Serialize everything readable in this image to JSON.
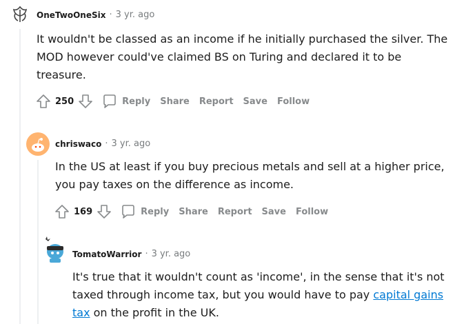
{
  "comments": [
    {
      "author": "OneTwoOneSix",
      "separator": "·",
      "time": "3 yr. ago",
      "body": "It wouldn't be classed as an income if he initially purchased the silver. The MOD however could've claimed BS on Turing and declared it to be treasure.",
      "score": "250",
      "actions": {
        "reply": "Reply",
        "share": "Share",
        "report": "Report",
        "save": "Save",
        "follow": "Follow"
      }
    },
    {
      "author": "chriswaco",
      "separator": "·",
      "time": "3 yr. ago",
      "body": "In the US at least if you buy precious metals and sell at a higher price, you pay taxes on the difference as income.",
      "score": "169",
      "actions": {
        "reply": "Reply",
        "share": "Share",
        "report": "Report",
        "save": "Save",
        "follow": "Follow"
      }
    },
    {
      "author": "TomatoWarrior",
      "separator": "·",
      "time": "3 yr. ago",
      "body_before": "It's true that it wouldn't count as 'income', in the sense that it's not taxed through income tax, but you would have to pay ",
      "link": "capital gains tax",
      "body_after": " on the profit in the UK."
    }
  ],
  "colors": {
    "link": "#0079d3",
    "meta": "#787c7e",
    "action": "#878a8c",
    "thread_line": "#edeff1"
  }
}
